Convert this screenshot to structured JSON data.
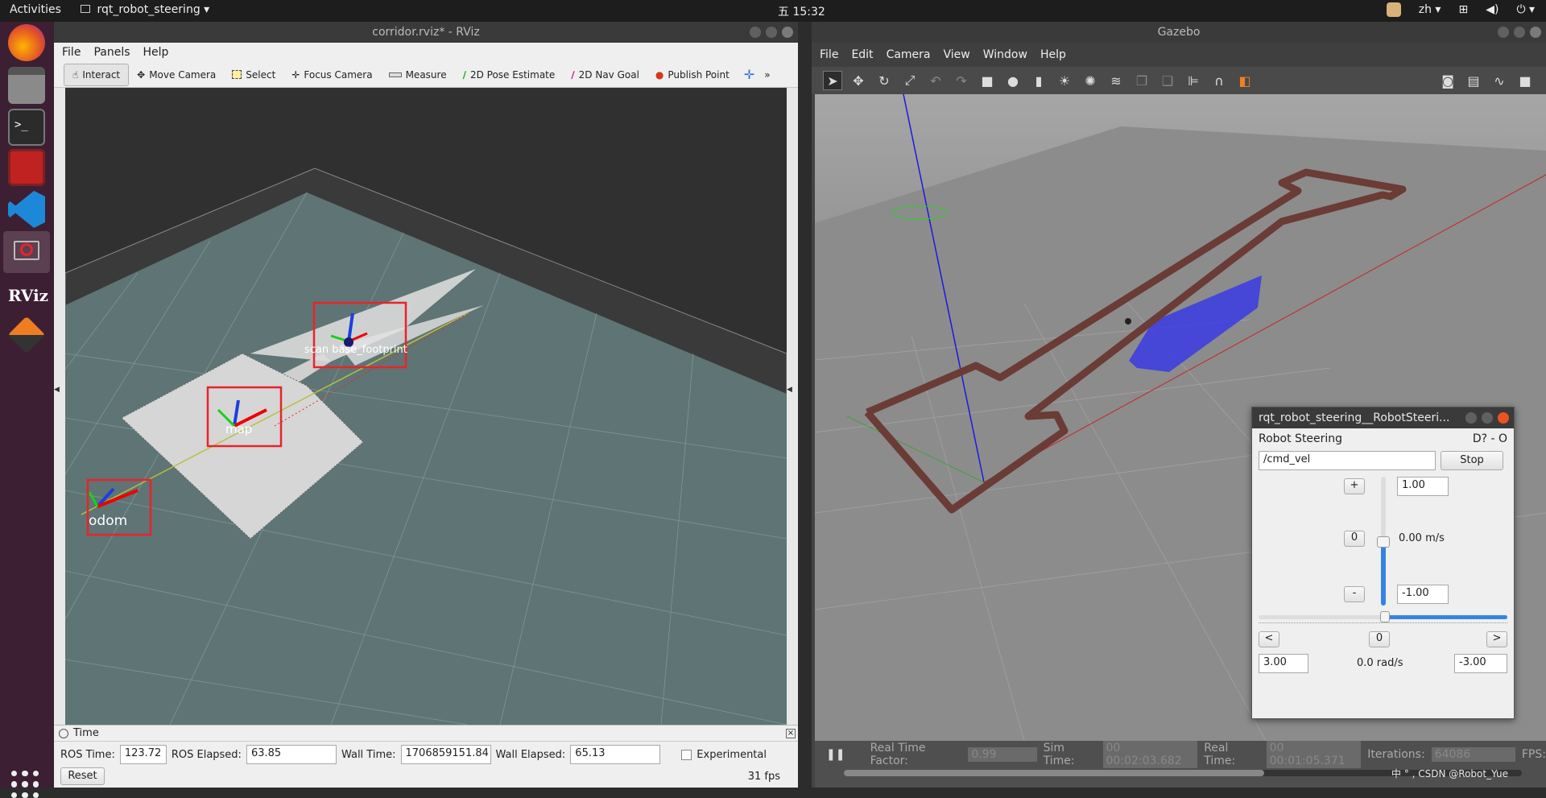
{
  "topbar": {
    "activities": "Activities",
    "app_name": "rqt_robot_steering",
    "clock": "五 15:32",
    "lang": "zh"
  },
  "rviz": {
    "title": "corridor.rviz* - RViz",
    "menu": [
      "File",
      "Panels",
      "Help"
    ],
    "tools": [
      "Interact",
      "Move Camera",
      "Select",
      "Focus Camera",
      "Measure",
      "2D Pose Estimate",
      "2D Nav Goal",
      "Publish Point"
    ],
    "frames": {
      "odom": "odom",
      "map": "map",
      "robot_overlap": "scan base_footprint"
    },
    "time_panel": {
      "title": "Time",
      "ros_time_label": "ROS Time:",
      "ros_time": "123.72",
      "ros_elapsed_label": "ROS Elapsed:",
      "ros_elapsed": "63.85",
      "wall_time_label": "Wall Time:",
      "wall_time": "1706859151.84",
      "wall_elapsed_label": "Wall Elapsed:",
      "wall_elapsed": "65.13",
      "experimental": "Experimental",
      "reset": "Reset",
      "fps": "31 fps"
    }
  },
  "gazebo": {
    "title": "Gazebo",
    "menu": [
      "File",
      "Edit",
      "Camera",
      "View",
      "Window",
      "Help"
    ],
    "status": {
      "rtf_label": "Real Time Factor:",
      "rtf": "0.99",
      "sim_time_label": "Sim Time:",
      "sim_time": "00 00:02:03.682",
      "real_time_label": "Real Time:",
      "real_time": "00 00:01:05.371",
      "iterations_label": "Iterations:",
      "iterations": "64086",
      "fps_label": "FPS:"
    },
    "watermark": "CSDN @Robot_Yue"
  },
  "steering": {
    "title": "rqt_robot_steering__RobotSteeri...",
    "plugin_label": "Robot Steering",
    "plugin_icons": "D?  -  O",
    "topic": "/cmd_vel",
    "stop": "Stop",
    "plus": "+",
    "minus": "-",
    "zero": "0",
    "max_linear": "1.00",
    "min_linear": "-1.00",
    "linear_value": "0.00 m/s",
    "left": "<",
    "right": ">",
    "angular_zero": "0",
    "max_angular": "3.00",
    "min_angular": "-3.00",
    "angular_value": "0.0 rad/s"
  },
  "colors": {
    "accent_blue": "#3584e4",
    "highlight_red": "#e8232b",
    "wall_brown": "#6b3b36"
  }
}
